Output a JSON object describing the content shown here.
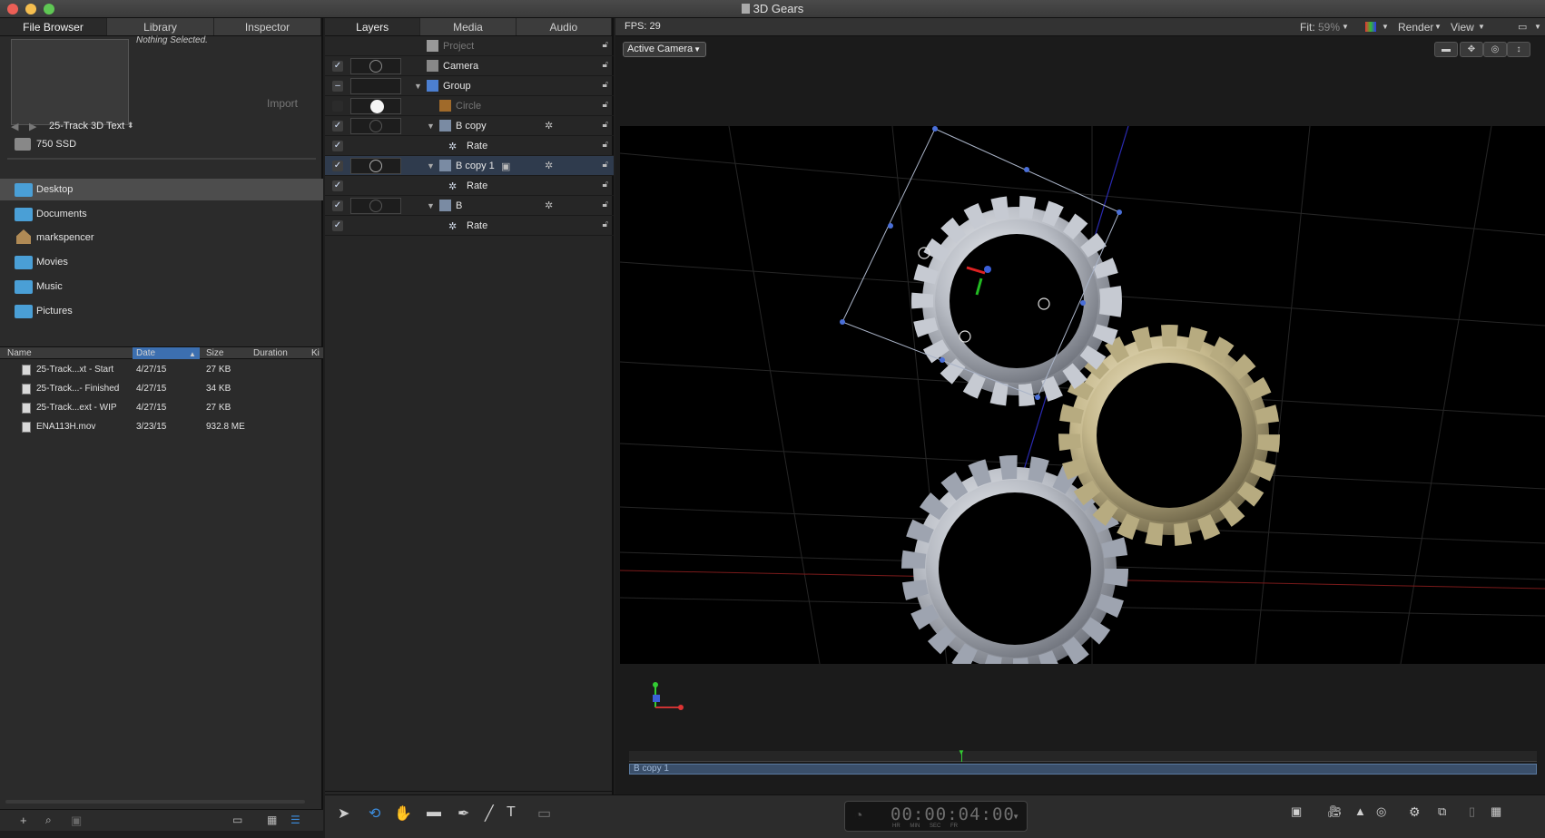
{
  "window": {
    "title": "3D Gears"
  },
  "left_panel": {
    "tabs": [
      "File Browser",
      "Library",
      "Inspector"
    ],
    "preview_status": "Nothing Selected.",
    "import_label": "Import",
    "current_folder": "25-Track 3D Text",
    "drive": "750 SSD",
    "favorites": [
      "Desktop",
      "Documents",
      "markspencer",
      "Movies",
      "Music",
      "Pictures"
    ],
    "file_columns": [
      "Name",
      "Date",
      "Size",
      "Duration",
      "Ki"
    ],
    "files": [
      {
        "name": "25-Track...xt - Start",
        "date": "4/27/15",
        "size": "27 KB"
      },
      {
        "name": "25-Track...- Finished",
        "date": "4/27/15",
        "size": "34 KB"
      },
      {
        "name": "25-Track...ext - WIP",
        "date": "4/27/15",
        "size": "27 KB"
      },
      {
        "name": "ENA113H.mov",
        "date": "3/23/15",
        "size": "932.8 ME"
      }
    ]
  },
  "layers_panel": {
    "tabs": [
      "Layers",
      "Media",
      "Audio"
    ],
    "rows": [
      {
        "name": "Project"
      },
      {
        "name": "Camera"
      },
      {
        "name": "Group"
      },
      {
        "name": "Circle"
      },
      {
        "name": "B copy"
      },
      {
        "name": "Rate"
      },
      {
        "name": "B copy 1"
      },
      {
        "name": "Rate"
      },
      {
        "name": "B"
      },
      {
        "name": "Rate"
      }
    ]
  },
  "canvas": {
    "fps_label": "FPS: 29",
    "fit_label": "Fit:",
    "fit_value": "59%",
    "render_menu": "Render",
    "view_menu": "View",
    "camera_dropdown": "Active Camera"
  },
  "timeline": {
    "clip_label": "B copy 1",
    "timecode": "00:00:04:00",
    "timecode_units": "HR MIN SEC FR"
  },
  "colors": {
    "selection_blue": "#3c6fb0",
    "record_red": "#d9363e",
    "folder_blue": "#4a9fd6"
  }
}
